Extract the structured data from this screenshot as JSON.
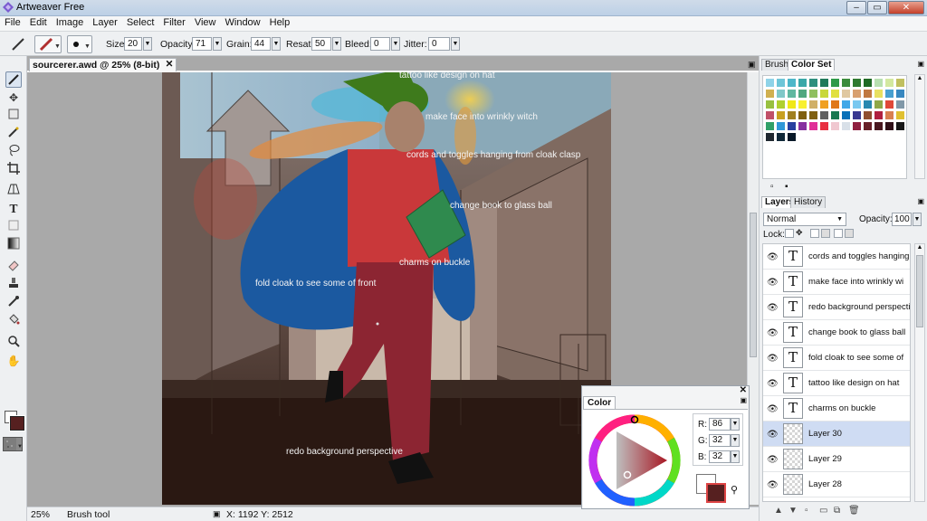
{
  "window": {
    "title": "Artweaver Free",
    "buttons": [
      "–",
      "▭",
      "✕"
    ]
  },
  "menu": [
    "File",
    "Edit",
    "Image",
    "Layer",
    "Select",
    "Filter",
    "View",
    "Window",
    "Help"
  ],
  "options": {
    "size_label": "Size:",
    "size": "20",
    "opacity_label": "Opacity:",
    "opacity": "71",
    "grain_label": "Grain:",
    "grain": "44",
    "resat_label": "Resat:",
    "resat": "50",
    "bleed_label": "Bleed:",
    "bleed": "0",
    "jitter_label": "Jitter:",
    "jitter": "0"
  },
  "tools": [
    "brush-tool",
    "move-tool",
    "marquee-tool",
    "magic-wand-tool",
    "lasso-tool",
    "crop-tool",
    "perspective-tool",
    "text-tool",
    "shape-tool",
    "gradient-tool",
    "eraser-tool",
    "clone-tool",
    "eyedropper-tool",
    "fill-tool",
    "zoom-tool",
    "hand-tool"
  ],
  "document": {
    "tab_label": "sourcerer.awd @ 25% (8-bit)",
    "annotations": [
      "tattoo like design on hat",
      "make face into wrinkly witch",
      "cords and toggles hanging from cloak clasp",
      "change book to glass ball",
      "charms on buckle",
      "fold cloak to see some of front",
      "redo background perspective"
    ]
  },
  "status": {
    "zoom": "25%",
    "tool": "Brush tool",
    "coords": "X: 1192  Y: 2512"
  },
  "color_panel": {
    "tab": "Color",
    "r_label": "R:",
    "r": "86",
    "g_label": "G:",
    "g": "32",
    "b_label": "B:",
    "b": "32",
    "foreground": "#562020"
  },
  "swatch_panel": {
    "tabs": [
      "Brush",
      "Color Set"
    ],
    "colors": [
      "#8fd3e8",
      "#6ec6d8",
      "#4db7c9",
      "#3aa8a8",
      "#2e8f7e",
      "#1f7a5a",
      "#2e9a48",
      "#3c8c3c",
      "#2f7a30",
      "#1f6a24",
      "#b8e0b0",
      "#d3e8a0",
      "#c0c060",
      "#d0b050",
      "#80c8c8",
      "#60b8a0",
      "#50a880",
      "#90c060",
      "#c8d838",
      "#e0e040",
      "#e0c8a0",
      "#d8a070",
      "#c07840",
      "#e8e060",
      "#48a0d0",
      "#3888c0",
      "#98c040",
      "#b0d030",
      "#f0e818",
      "#f8f030",
      "#d0b068",
      "#f0a020",
      "#e07818",
      "#40a8e8",
      "#78c8f0",
      "#2888b0",
      "#90a848",
      "#e04838",
      "#8098a8",
      "#c05068",
      "#c8a020",
      "#a08020",
      "#806010",
      "#806010",
      "#606060",
      "#187850",
      "#0870b8",
      "#383890",
      "#905030",
      "#b02040",
      "#d88050",
      "#e0c030",
      "#30a068",
      "#3098d8",
      "#2840a0",
      "#8830a0",
      "#e03098",
      "#e83040",
      "#f0c8d0",
      "#d8e0e8",
      "#902040",
      "#682028",
      "#4a1820",
      "#301018",
      "#181818",
      "#202830",
      "#102838",
      "#081828"
    ]
  },
  "layers_panel": {
    "tabs": [
      "Layers",
      "History"
    ],
    "blend_mode": "Normal",
    "opacity_label": "Opacity:",
    "opacity": "100",
    "lock_label": "Lock:",
    "layers": [
      {
        "name": "cords and toggles hanging",
        "type": "text",
        "selected": false
      },
      {
        "name": "make face into wrinkly wi",
        "type": "text",
        "selected": false
      },
      {
        "name": "redo background perspecti",
        "type": "text",
        "selected": false
      },
      {
        "name": "change book to glass ball",
        "type": "text",
        "selected": false
      },
      {
        "name": "fold cloak to see some of",
        "type": "text",
        "selected": false
      },
      {
        "name": "tattoo like design on hat",
        "type": "text",
        "selected": false
      },
      {
        "name": "charms on buckle",
        "type": "text",
        "selected": false
      },
      {
        "name": "Layer 30",
        "type": "raster",
        "selected": true
      },
      {
        "name": "Layer 29",
        "type": "raster",
        "selected": false
      },
      {
        "name": "Layer 28",
        "type": "raster",
        "selected": false
      }
    ],
    "text_glyph": "T"
  }
}
